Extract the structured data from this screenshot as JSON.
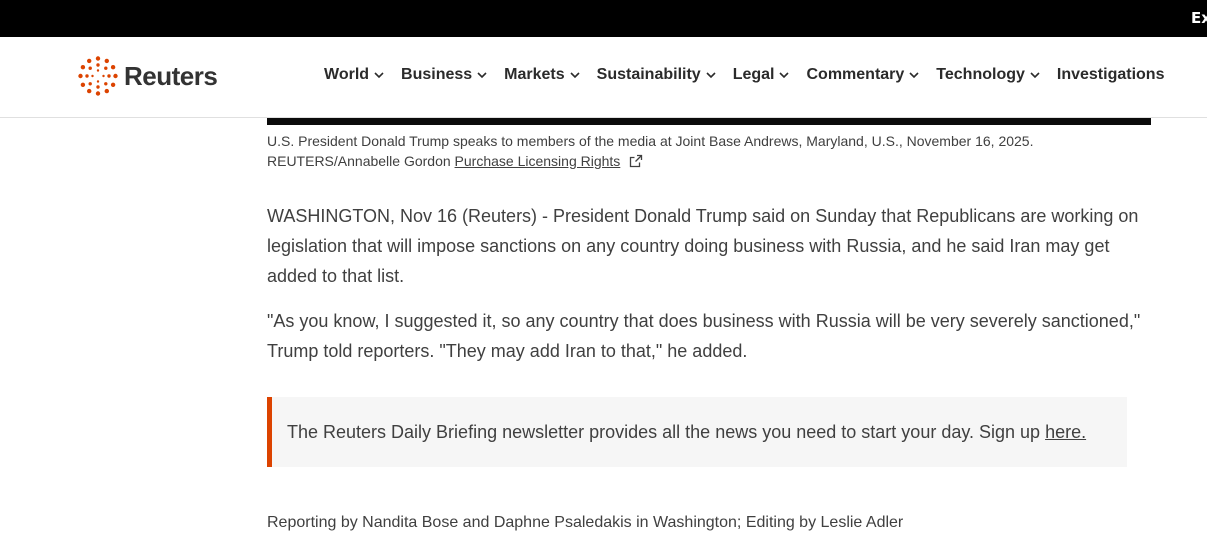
{
  "topbar": {
    "text": "Ex"
  },
  "header": {
    "logo_text": "Reuters",
    "brand_color": "#dc4300",
    "nav": [
      {
        "label": "World",
        "icon": "chevron-down-icon"
      },
      {
        "label": "Business",
        "icon": "chevron-down-icon"
      },
      {
        "label": "Markets",
        "icon": "chevron-down-icon"
      },
      {
        "label": "Sustainability",
        "icon": "chevron-down-icon"
      },
      {
        "label": "Legal",
        "icon": "chevron-down-icon"
      },
      {
        "label": "Commentary",
        "icon": "chevron-down-icon"
      },
      {
        "label": "Technology",
        "icon": "chevron-down-icon"
      },
      {
        "label": "Investigations"
      }
    ]
  },
  "caption": {
    "text": "U.S. President Donald Trump speaks to members of the media at Joint Base Andrews, Maryland, U.S., November 16, 2025.",
    "credit": "REUTERS/Annabelle Gordon",
    "license_link": "Purchase Licensing Rights",
    "license_icon": "external-link-icon"
  },
  "article": {
    "paragraphs": [
      "WASHINGTON, Nov 16 (Reuters) - President Donald Trump said on Sunday that Republicans are working on legislation that will impose sanctions on any country doing business with Russia, and he said Iran may get added to that list.",
      "\"As you know, I suggested it, so any country that does business with Russia will be very severely sanctioned,\" Trump told reporters. \"They may add Iran to that,\" he added."
    ],
    "briefing": {
      "text": "The Reuters Daily Briefing newsletter provides all the news you need to start your day. Sign up",
      "link": "here.",
      "accent_color": "#dc4300"
    },
    "credit": "Reporting by Nandita Bose and Daphne Psaledakis in Washington; Editing by Leslie Adler"
  }
}
